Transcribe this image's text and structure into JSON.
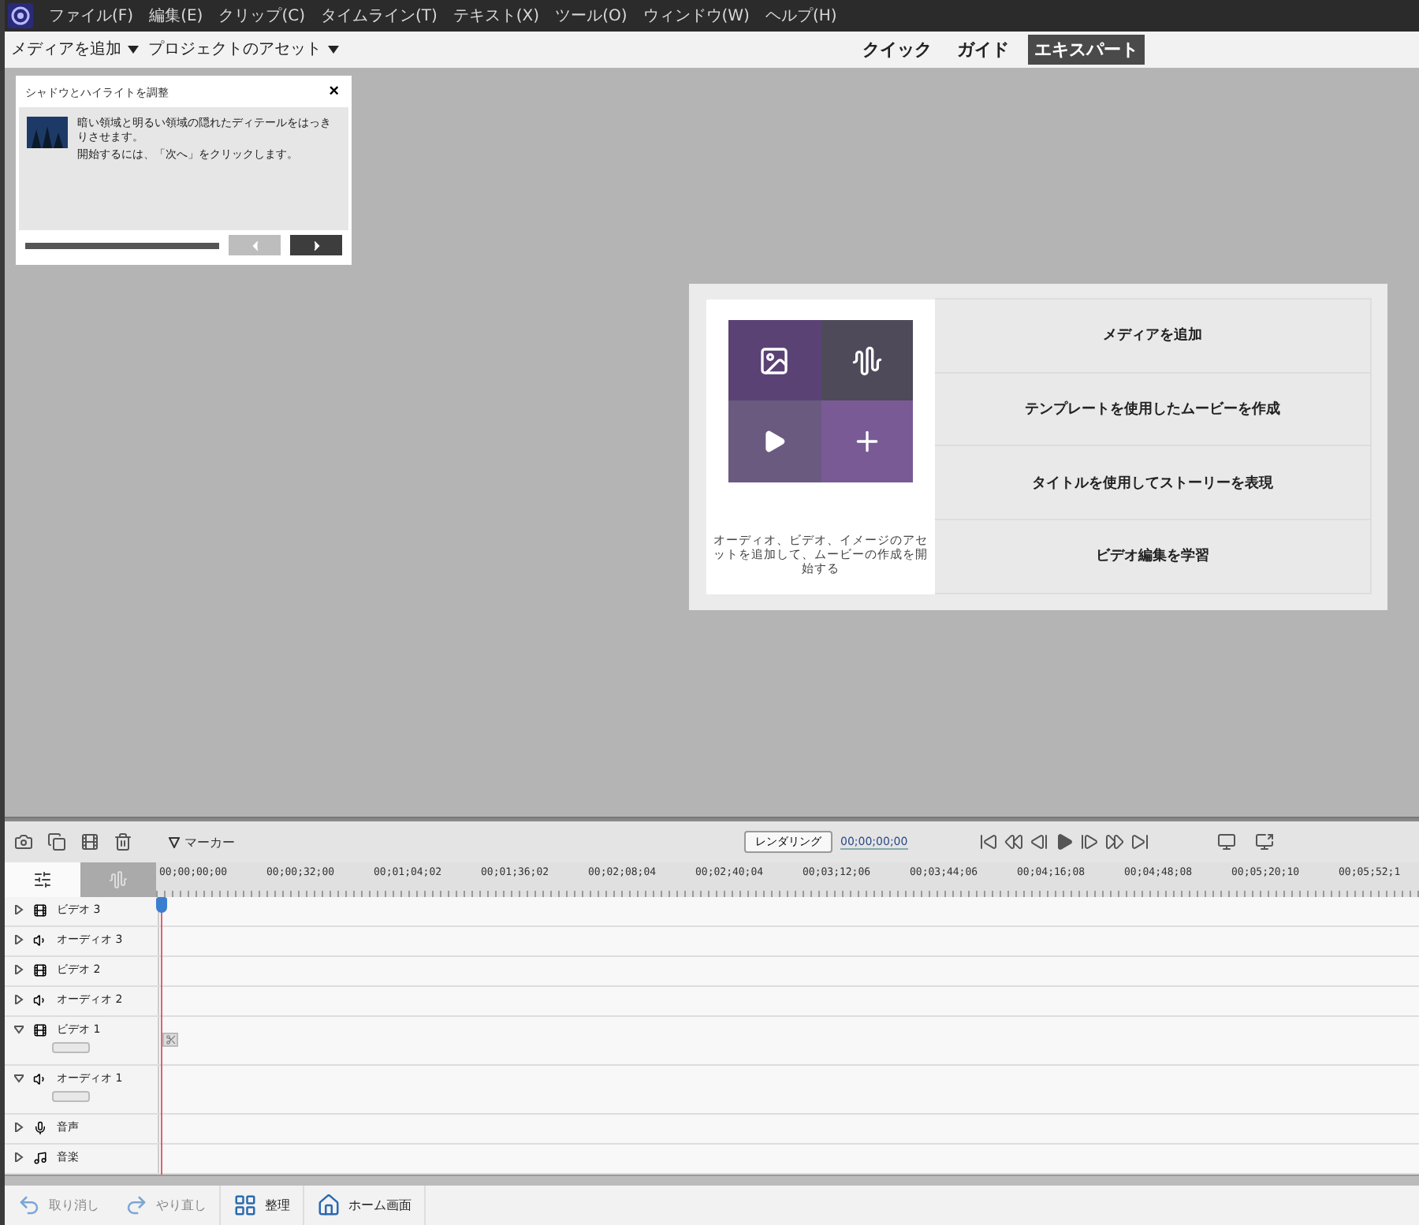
{
  "menu_bar": {
    "items": [
      "ファイル(F)",
      "編集(E)",
      "クリップ(C)",
      "タイムライン(T)",
      "テキスト(X)",
      "ツール(O)",
      "ウィンドウ(W)",
      "ヘルプ(H)"
    ]
  },
  "toolbar": {
    "dropdowns": [
      "メディアを追加",
      "プロジェクトのアセット"
    ],
    "modes": [
      {
        "label": "クイック",
        "selected": false
      },
      {
        "label": "ガイド",
        "selected": false
      },
      {
        "label": "エキスパート",
        "selected": true
      }
    ]
  },
  "guide_panel": {
    "title": "シャドウとハイライトを調整",
    "close": "×",
    "paragraphs": [
      "暗い領域と明るい領域の隠れたディテールをはっきりさせます。",
      "開始するには、「次へ」をクリックします。"
    ],
    "progress": {
      "level": 1
    },
    "buttons": [
      {
        "kind": "back",
        "disabled": true
      },
      {
        "kind": "next",
        "disabled": false
      }
    ]
  },
  "welcome": {
    "caption": "オーディオ、ビデオ、イメージのアセットを追加して、ムービーの作成を開始する",
    "actions": [
      "メディアを追加",
      "テンプレートを使用したムービーを作成",
      "タイトルを使用してストーリーを表現",
      "ビデオ編集を学習"
    ]
  },
  "timeline": {
    "marker_label": "マーカー",
    "render_label": "レンダリング",
    "timecode": "00;00;00;00",
    "view_tabs": [
      {
        "kind": "properties",
        "selected": true
      },
      {
        "kind": "effects",
        "selected": false
      }
    ],
    "ruler": [
      "00;00;00;00",
      "00;00;32;00",
      "00;01;04;02",
      "00;01;36;02",
      "00;02;08;04",
      "00;02;40;04",
      "00;03;12;06",
      "00;03;44;06",
      "00;04;16;08",
      "00;04;48;08",
      "00;05;20;10",
      "00;05;52;1"
    ],
    "tracks": [
      {
        "name": "ビデオ 3",
        "kind": "video",
        "expanded": false
      },
      {
        "name": "オーディオ 3",
        "kind": "audio",
        "expanded": false
      },
      {
        "name": "ビデオ 2",
        "kind": "video",
        "expanded": false
      },
      {
        "name": "オーディオ 2",
        "kind": "audio",
        "expanded": false
      },
      {
        "name": "ビデオ 1",
        "kind": "video",
        "expanded": true
      },
      {
        "name": "オーディオ 1",
        "kind": "audio",
        "expanded": true
      },
      {
        "name": "音声",
        "kind": "voice",
        "expanded": false
      },
      {
        "name": "音楽",
        "kind": "music",
        "expanded": false
      }
    ]
  },
  "bottom_bar": {
    "buttons": [
      {
        "label": "取り消し",
        "kind": "undo",
        "disabled": true
      },
      {
        "label": "やり直し",
        "kind": "redo",
        "disabled": true
      },
      {
        "label": "整理",
        "kind": "organize",
        "disabled": false
      },
      {
        "label": "ホーム画面",
        "kind": "home",
        "disabled": false
      }
    ]
  }
}
